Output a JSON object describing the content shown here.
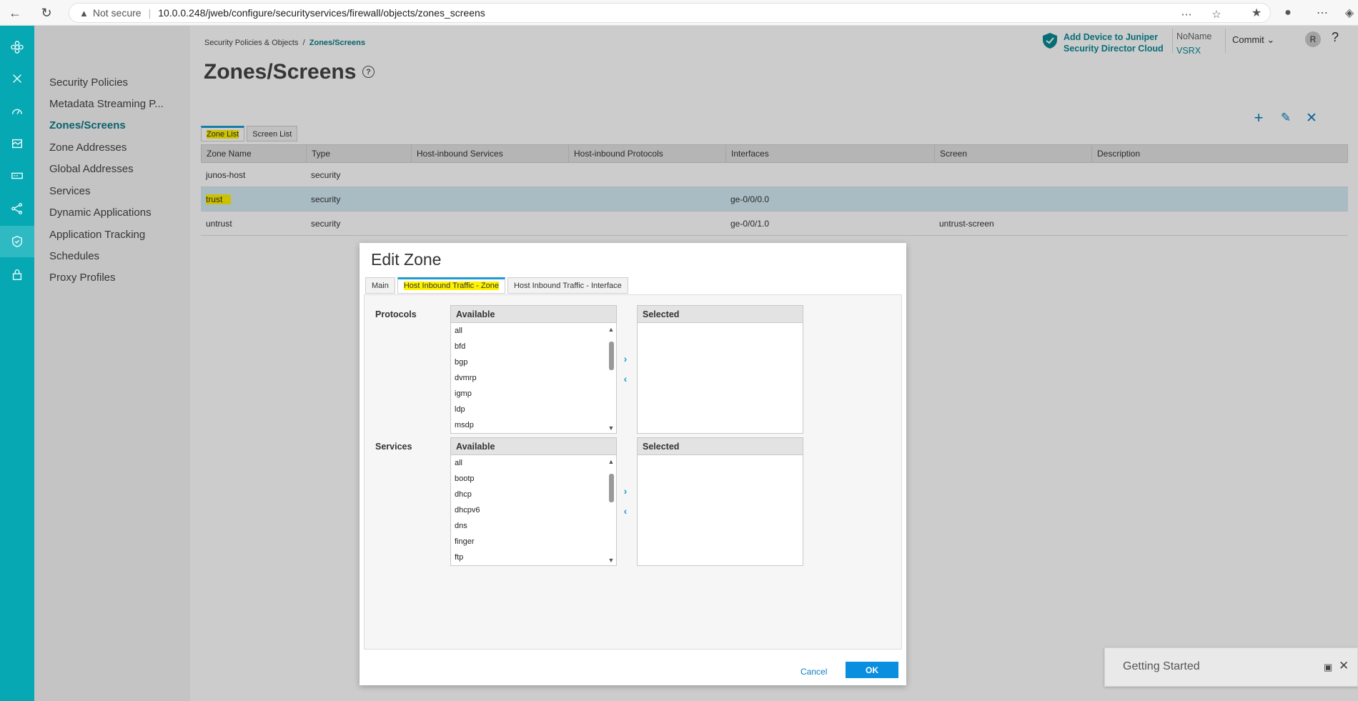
{
  "browser": {
    "not_secure": "Not secure",
    "url": "10.0.0.248/jweb/configure/securityservices/firewall/objects/zones_screens"
  },
  "sidenav": {
    "items": [
      {
        "label": "Security Policies"
      },
      {
        "label": "Metadata Streaming P..."
      },
      {
        "label": "Zones/Screens"
      },
      {
        "label": "Zone Addresses"
      },
      {
        "label": "Global Addresses"
      },
      {
        "label": "Services"
      },
      {
        "label": "Dynamic Applications"
      },
      {
        "label": "Application Tracking"
      },
      {
        "label": "Schedules"
      },
      {
        "label": "Proxy Profiles"
      }
    ],
    "active_index": 2
  },
  "header": {
    "breadcrumb_parent": "Security Policies & Objects",
    "breadcrumb_sep": "/",
    "breadcrumb_current": "Zones/Screens",
    "page_title": "Zones/Screens",
    "help_mark": "?",
    "promo_line1": "Add Device to Juniper",
    "promo_line2": "Security Director Cloud",
    "device_name": "NoName",
    "device_model": "VSRX",
    "commit_label": "Commit",
    "avatar_initial": "R",
    "help_label": "?"
  },
  "tabs": [
    {
      "label": "Zone List"
    },
    {
      "label": "Screen List"
    }
  ],
  "grid": {
    "columns": [
      "Zone Name",
      "Type",
      "Host-inbound Services",
      "Host-inbound Protocols",
      "Interfaces",
      "Screen",
      "Description"
    ],
    "rows": [
      {
        "zone": "junos-host",
        "type": "security",
        "services": "",
        "protocols": "",
        "interfaces": "",
        "screen": "",
        "description": ""
      },
      {
        "zone": "trust",
        "type": "security",
        "services": "",
        "protocols": "",
        "interfaces": "ge-0/0/0.0",
        "screen": "",
        "description": ""
      },
      {
        "zone": "untrust",
        "type": "security",
        "services": "",
        "protocols": "",
        "interfaces": "ge-0/0/1.0",
        "screen": "untrust-screen",
        "description": ""
      }
    ]
  },
  "dialog": {
    "title": "Edit Zone",
    "tabs": [
      {
        "label": "Main"
      },
      {
        "label": "Host Inbound Traffic - Zone"
      },
      {
        "label": "Host Inbound Traffic - Interface"
      }
    ],
    "protocols": {
      "label": "Protocols",
      "available_header": "Available",
      "selected_header": "Selected",
      "options": [
        "all",
        "bfd",
        "bgp",
        "dvmrp",
        "igmp",
        "ldp",
        "msdp"
      ]
    },
    "services": {
      "label": "Services",
      "available_header": "Available",
      "selected_header": "Selected",
      "options": [
        "all",
        "bootp",
        "dhcp",
        "dhcpv6",
        "dns",
        "finger",
        "ftp"
      ]
    },
    "cancel_label": "Cancel",
    "ok_label": "OK"
  },
  "getting_started": {
    "title": "Getting Started"
  },
  "colors": {
    "rail": "#05a8b3",
    "accent": "#0c7b87",
    "primary_button": "#0a8fe0",
    "highlight": "#fff200"
  }
}
